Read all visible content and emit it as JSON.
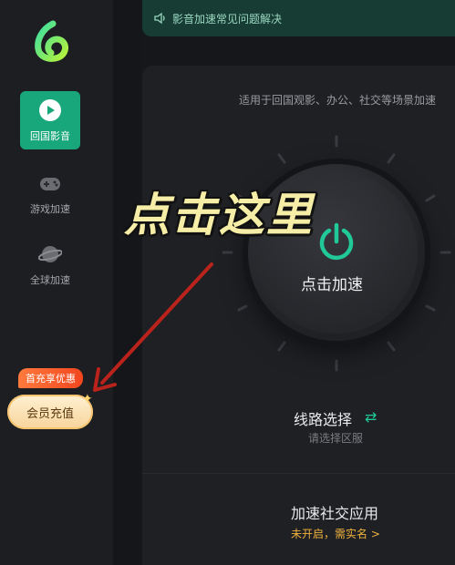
{
  "notice": {
    "text": "影音加速常见问题解决",
    "icon": "speaker-icon"
  },
  "sidebar": {
    "items": [
      {
        "label": "回国影音",
        "icon": "play-icon",
        "active": true
      },
      {
        "label": "游戏加速",
        "icon": "gamepad-icon",
        "active": false
      },
      {
        "label": "全球加速",
        "icon": "planet-icon",
        "active": false
      }
    ],
    "promo_tag": "首充享优惠",
    "member_button": "会员充值"
  },
  "main": {
    "subtitle": "适用于回国观影、办公、社交等场景加速",
    "dial_label": "点击加速",
    "route_title": "线路选择",
    "route_sub": "请选择区服",
    "social_title": "加速社交应用",
    "social_sub": "未开启，需实名 >"
  },
  "overlay": {
    "callout": "点击这里"
  },
  "colors": {
    "accent": "#18a77a",
    "accent_bright": "#20c997",
    "warning": "#f0b23e",
    "background": "#16171b",
    "arrow": "#b9231b"
  }
}
